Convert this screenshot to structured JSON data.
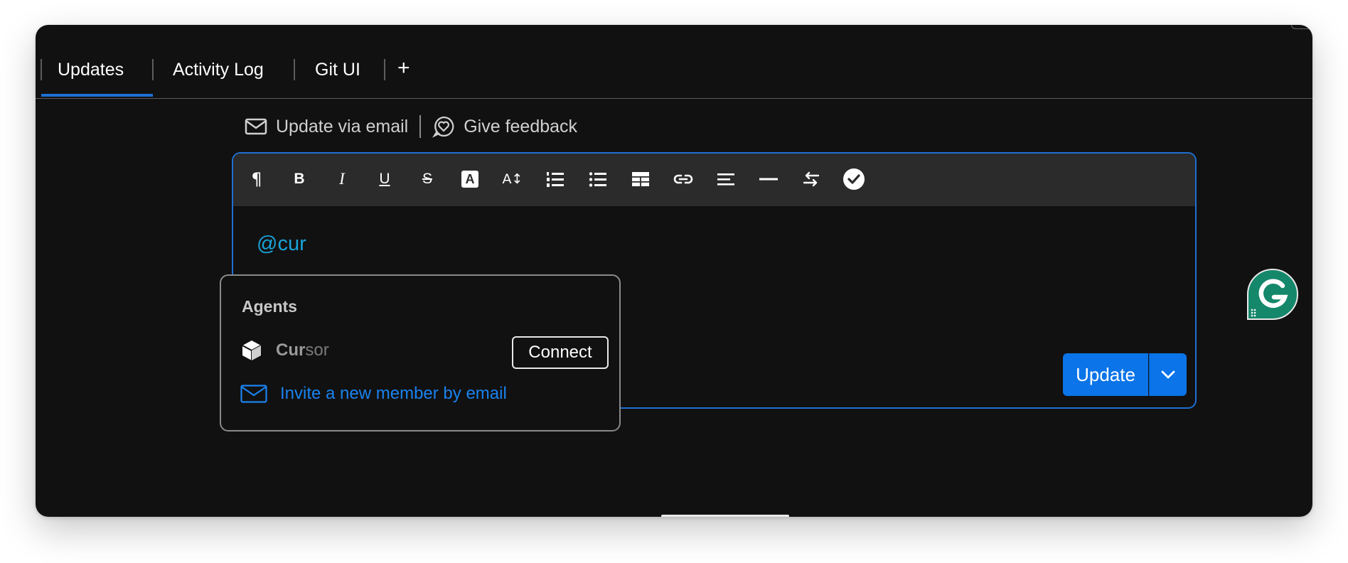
{
  "tabs": [
    {
      "label": "Updates"
    },
    {
      "label": "Activity Log"
    },
    {
      "label": "Git UI"
    }
  ],
  "tab_add_label": "+",
  "actions": {
    "email_label": "Update via email",
    "feedback_label": "Give feedback"
  },
  "editor": {
    "content": "@cur",
    "toolbar_icons": [
      "paragraph-icon",
      "bold-icon",
      "italic-icon",
      "underline-icon",
      "strikethrough-icon",
      "text-color-icon",
      "font-size-icon",
      "numbered-list-icon",
      "bullet-list-icon",
      "table-icon",
      "link-icon",
      "align-left-icon",
      "divider-icon",
      "direction-icon",
      "checklist-icon"
    ],
    "bold_label": "B",
    "italic_label": "I",
    "underline_label": "U",
    "strike_label": "S",
    "text_color_label": "A",
    "font_size_label": "A↕"
  },
  "update_button": {
    "label": "Update"
  },
  "mention_popup": {
    "title": "Agents",
    "agent": {
      "name_match": "Cur",
      "name_rest": "sor",
      "action_label": "Connect"
    },
    "invite_label": "Invite a new member by email"
  },
  "colors": {
    "background": "#111111",
    "toolbar": "#2b2b2b",
    "accent": "#0a74e8",
    "mention": "#1aa3d9",
    "grammarly": "#15876b"
  }
}
